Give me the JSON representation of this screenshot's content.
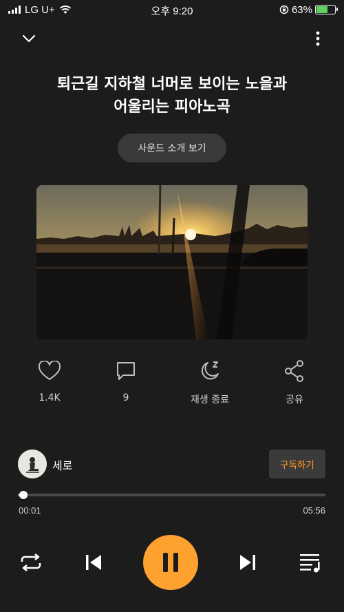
{
  "status_bar": {
    "carrier": "LG U+",
    "time": "오후 9:20",
    "battery_percent": "63%",
    "battery_level": 0.63,
    "icons": [
      "signal-icon",
      "wifi-icon",
      "orientation-lock-icon",
      "battery-charging-icon"
    ]
  },
  "nav": {
    "close_icon": "chevron-down-icon",
    "more_icon": "more-vertical-icon"
  },
  "track": {
    "title_line1": "퇴근길 지하철 너머로 보이는 노을과",
    "title_line2": "어울리는 피아노곡",
    "intro_button": "사운드 소개 보기",
    "artwork": "sunset-over-river-photo"
  },
  "actions": {
    "like_count": "1.4K",
    "comment_count": "9",
    "sleep_label": "재생 종료",
    "share_label": "공유",
    "icons": [
      "heart-icon",
      "comment-icon",
      "sleep-timer-icon",
      "share-icon"
    ]
  },
  "artist": {
    "name": "세로",
    "subscribe_label": "구독하기"
  },
  "playback": {
    "elapsed": "00:01",
    "duration": "05:56",
    "progress_fraction": 0.003
  },
  "controls": {
    "icons": [
      "repeat-icon",
      "previous-icon",
      "pause-icon",
      "next-icon",
      "playlist-icon"
    ]
  },
  "colors": {
    "background": "#1c1c1c",
    "accent": "#ffa12e",
    "subscribe_text": "#ff9a1f",
    "battery_fill": "#5fd35f"
  }
}
